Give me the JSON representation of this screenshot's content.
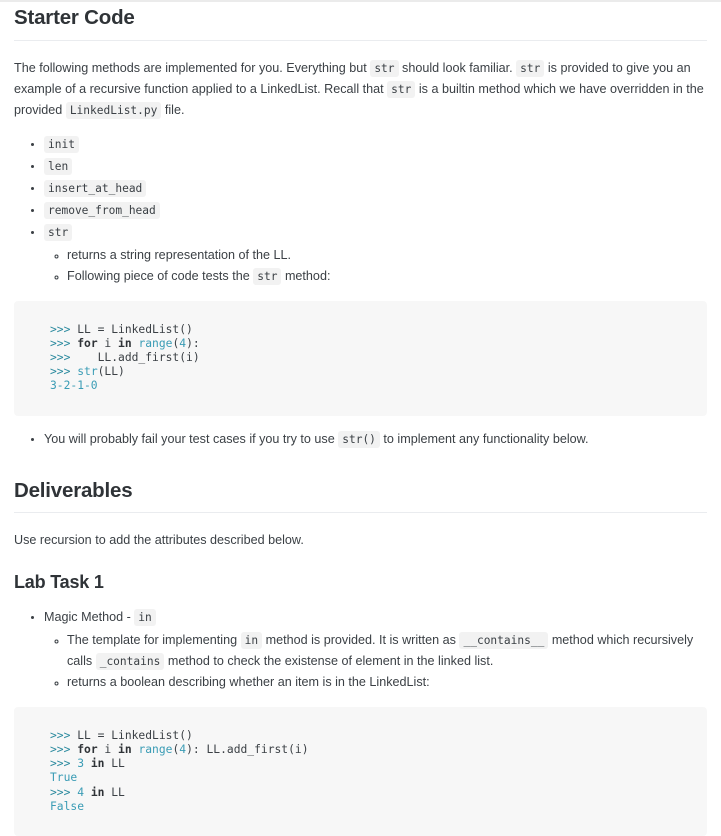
{
  "sections": {
    "starter_code": {
      "heading": "Starter Code",
      "paragraph": {
        "p1": "The following methods are implemented for you. Everything but",
        "c1": "str",
        "p2": "should look familiar.",
        "c2": "str",
        "p3": "is provided to give you an example of a recursive function applied to a LinkedList. Recall that",
        "c3": "str",
        "p4": "is a builtin method which we have overridden in the provided",
        "c4": "LinkedList.py",
        "p5": "file."
      },
      "methods": [
        "init",
        "len",
        "insert_at_head",
        "remove_from_head",
        "str"
      ],
      "str_subitems": {
        "s1": "returns a string representation of the LL.",
        "s2_pre": "Following piece of code tests the",
        "s2_code": "str",
        "s2_post": "method:"
      },
      "code_block": {
        "lines": [
          {
            "prompt": ">>> ",
            "parts": [
              {
                "t": "plain",
                "v": "LL = LinkedList()"
              }
            ]
          },
          {
            "prompt": ">>> ",
            "parts": [
              {
                "t": "kw",
                "v": "for"
              },
              {
                "t": "plain",
                "v": " i "
              },
              {
                "t": "kw",
                "v": "in"
              },
              {
                "t": "plain",
                "v": " "
              },
              {
                "t": "fn",
                "v": "range"
              },
              {
                "t": "plain",
                "v": "("
              },
              {
                "t": "num",
                "v": "4"
              },
              {
                "t": "plain",
                "v": "):"
              }
            ]
          },
          {
            "prompt": ">>> ",
            "parts": [
              {
                "t": "plain",
                "v": "   LL.add_first(i)"
              }
            ]
          },
          {
            "prompt": ">>> ",
            "parts": [
              {
                "t": "fn",
                "v": "str"
              },
              {
                "t": "plain",
                "v": "(LL)"
              }
            ]
          },
          {
            "prompt": "",
            "parts": [
              {
                "t": "out",
                "v": "3-2-1-0"
              }
            ]
          }
        ]
      },
      "warning": {
        "pre": "You will probably fail your test cases if you try to use",
        "code": "str()",
        "post": "to implement any functionality below."
      }
    },
    "deliverables": {
      "heading": "Deliverables",
      "paragraph": "Use recursion to add the attributes described below."
    },
    "lab_task_1": {
      "heading": "Lab Task 1",
      "bullet": {
        "label": "Magic Method -",
        "code": "in"
      },
      "subitems": {
        "t1_p1": "The template for implementing",
        "t1_c1": "in",
        "t1_p2": "method is provided. It is written as",
        "t1_c2": "__contains__",
        "t1_p3": "method which recursively calls",
        "t1_c3": "_contains",
        "t1_p4": "method to check the existense of element in the linked list.",
        "t2": "returns a boolean describing whether an item is in the LinkedList:"
      },
      "code_block": {
        "lines": [
          {
            "prompt": ">>> ",
            "parts": [
              {
                "t": "plain",
                "v": "LL = LinkedList()"
              }
            ]
          },
          {
            "prompt": ">>> ",
            "parts": [
              {
                "t": "kw",
                "v": "for"
              },
              {
                "t": "plain",
                "v": " i "
              },
              {
                "t": "kw",
                "v": "in"
              },
              {
                "t": "plain",
                "v": " "
              },
              {
                "t": "fn",
                "v": "range"
              },
              {
                "t": "plain",
                "v": "("
              },
              {
                "t": "num",
                "v": "4"
              },
              {
                "t": "plain",
                "v": "): LL.add_first(i)"
              }
            ]
          },
          {
            "prompt": ">>> ",
            "parts": [
              {
                "t": "num",
                "v": "3"
              },
              {
                "t": "plain",
                "v": " "
              },
              {
                "t": "kw",
                "v": "in"
              },
              {
                "t": "plain",
                "v": " LL"
              }
            ]
          },
          {
            "prompt": "",
            "parts": [
              {
                "t": "out",
                "v": "True"
              }
            ]
          },
          {
            "prompt": ">>> ",
            "parts": [
              {
                "t": "num",
                "v": "4"
              },
              {
                "t": "plain",
                "v": " "
              },
              {
                "t": "kw",
                "v": "in"
              },
              {
                "t": "plain",
                "v": " LL"
              }
            ]
          },
          {
            "prompt": "",
            "parts": [
              {
                "t": "out",
                "v": "False"
              }
            ]
          }
        ]
      }
    }
  },
  "colors": {
    "page_background": "#ffffff",
    "text": "#3b4045",
    "heading": "#2f3337",
    "rule": "#eaecef",
    "code_block_bg": "#f7f7f7",
    "inline_code_bg": "#f2f2f2",
    "syntax_teal": "#3a9cb5",
    "syntax_prompt": "#2b8a9e",
    "syntax_keyword": "#2f3337"
  }
}
